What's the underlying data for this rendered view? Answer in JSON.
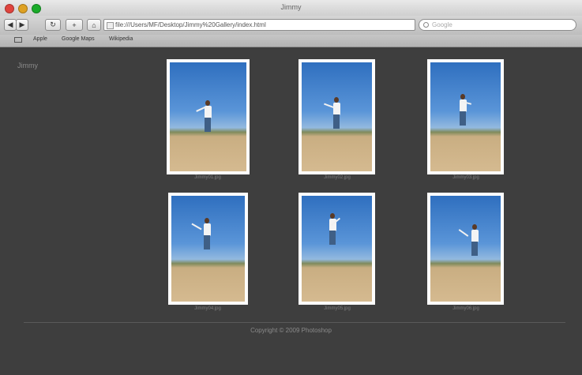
{
  "window": {
    "title": "Jimmy"
  },
  "toolbar": {
    "url": "file:///Users/MF/Desktop/Jimmy%20Gallery/index.html",
    "search_placeholder": "Google"
  },
  "bookmarks": [
    "Apple",
    "Google Maps",
    "Wikipedia"
  ],
  "gallery": {
    "title": "Jimmy",
    "captions": [
      "Jimmy01.jpg",
      "Jimmy02.jpg",
      "Jimmy03.jpg",
      "Jimmy04.jpg",
      "Jimmy05.jpg",
      "Jimmy06.jpg"
    ],
    "footer": "Copyright © 2009 Photoshop"
  }
}
